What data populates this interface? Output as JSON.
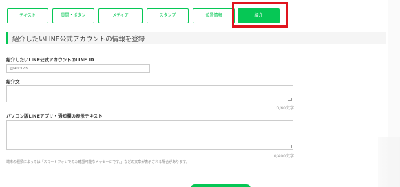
{
  "tabs": [
    {
      "label": "テキスト"
    },
    {
      "label": "質問・ボタン"
    },
    {
      "label": "メディア"
    },
    {
      "label": "スタンプ"
    },
    {
      "label": "位置情報"
    },
    {
      "label": "紹介",
      "active": true
    }
  ],
  "section": {
    "title": "紹介したいLINE公式アカウントの情報を登録"
  },
  "line_id": {
    "label": "紹介したいLINE公式アカウントのLINE ID",
    "placeholder": "@abc123"
  },
  "intro_text": {
    "label": "紹介文",
    "counter": "0/60文字"
  },
  "pc_text": {
    "label": "パソコン版LINEアプリ・通知欄の表示テキスト",
    "counter": "0/400文字"
  },
  "note": "端末の種類によっては「スマートフォンでのみ確認可能なメッセージです。」などの文章が表示される場合があります。",
  "colors": {
    "accent": "#06c755",
    "highlight": "#e0141e"
  }
}
